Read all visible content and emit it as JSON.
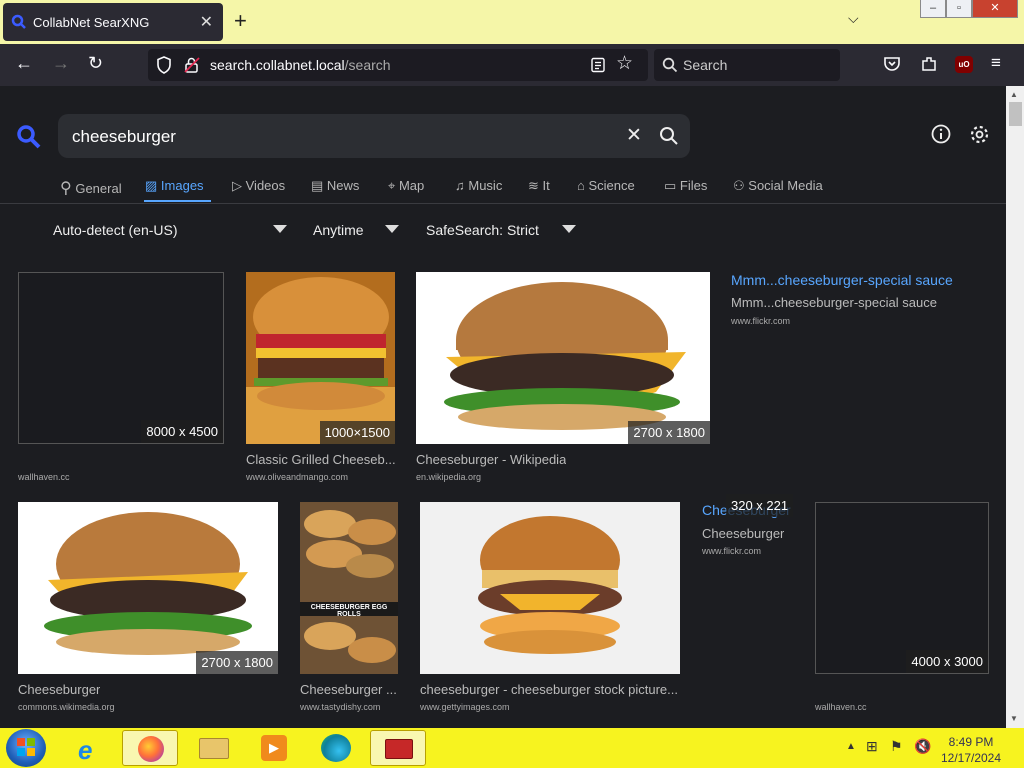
{
  "browser": {
    "tab_title": "CollabNet SearXNG",
    "url_host": "search.collabnet.local",
    "url_path": "/search",
    "search_placeholder": "Search"
  },
  "search": {
    "query": "cheeseburger"
  },
  "categories": [
    {
      "label": "General"
    },
    {
      "label": "Images"
    },
    {
      "label": "Videos"
    },
    {
      "label": "News"
    },
    {
      "label": "Map"
    },
    {
      "label": "Music"
    },
    {
      "label": "It"
    },
    {
      "label": "Science"
    },
    {
      "label": "Files"
    },
    {
      "label": "Social Media"
    }
  ],
  "filters": {
    "language": "Auto-detect (en-US)",
    "time": "Anytime",
    "safesearch": "SafeSearch: Strict"
  },
  "results": [
    {
      "caption": "",
      "source": "wallhaven.cc",
      "size": "8000 x 4500"
    },
    {
      "caption": "Classic Grilled Cheeseb...",
      "source": "www.oliveandmango.com",
      "size": "1000×1500"
    },
    {
      "caption": "Cheeseburger - Wikipedia",
      "source": "en.wikipedia.org",
      "size": "2700 x 1800"
    },
    {
      "caption": "Mmm...cheeseburger-special sauce",
      "title": "Mmm...cheeseburger-special sauce",
      "source": "www.flickr.com"
    },
    {
      "caption": "Cheeseburger",
      "source": "commons.wikimedia.org",
      "size": "2700 x 1800"
    },
    {
      "caption": "Cheeseburger ...",
      "source": "www.tastydishy.com",
      "image_text": "CHEESEBURGER EGG ROLLS"
    },
    {
      "caption": "cheeseburger - cheeseburger stock picture...",
      "source": "www.gettyimages.com"
    },
    {
      "caption": "Cheeseburger",
      "title": "Cheeseburger",
      "source": "www.flickr.com",
      "size": "320 x 221"
    },
    {
      "caption": "",
      "source": "wallhaven.cc",
      "size": "4000 x 3000"
    }
  ],
  "taskbar": {
    "time": "8:49 PM",
    "date": "12/17/2024"
  },
  "colors": {
    "accent": "#58a6ff",
    "page_bg": "#1c1d21",
    "taskbar": "#f7f31f",
    "tabbar": "#f5f6a8"
  }
}
